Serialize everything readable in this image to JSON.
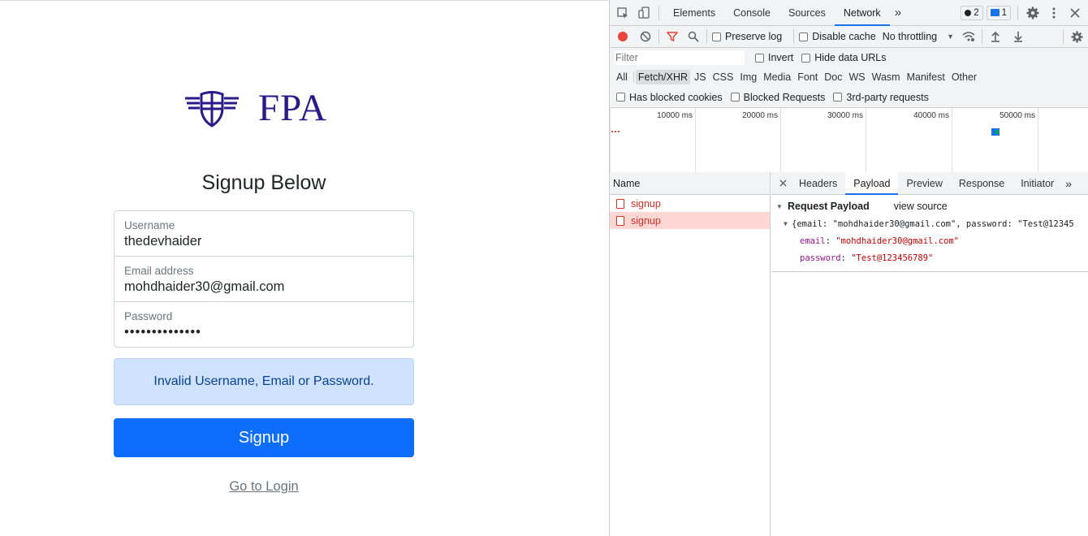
{
  "app": {
    "logo_text": "FPA",
    "heading": "Signup Below",
    "fields": {
      "username": {
        "label": "Username",
        "value": "thedevhaider"
      },
      "email": {
        "label": "Email address",
        "value": "mohdhaider30@gmail.com"
      },
      "password": {
        "label": "Password",
        "value": "••••••••••••••"
      }
    },
    "alert": "Invalid Username, Email or Password.",
    "signup_button": "Signup",
    "login_link": "Go to Login",
    "colors": {
      "primary": "#0d6efd",
      "alert_bg": "#cfe2ff",
      "alert_text": "#084298",
      "logo": "#2a1a8a"
    }
  },
  "devtools": {
    "tabs": [
      "Elements",
      "Console",
      "Sources",
      "Network"
    ],
    "active_tab": "Network",
    "more_tabs": "»",
    "errors_count": "2",
    "messages_count": "1",
    "toolbar": {
      "preserve_log": "Preserve log",
      "disable_cache": "Disable cache",
      "throttling": "No throttling"
    },
    "filter": {
      "placeholder": "Filter",
      "invert": "Invert",
      "hide_data_urls": "Hide data URLs"
    },
    "types": [
      "All",
      "Fetch/XHR",
      "JS",
      "CSS",
      "Img",
      "Media",
      "Font",
      "Doc",
      "WS",
      "Wasm",
      "Manifest",
      "Other"
    ],
    "active_type": "Fetch/XHR",
    "blocking": {
      "blocked_cookies": "Has blocked cookies",
      "blocked_requests": "Blocked Requests",
      "third_party": "3rd-party requests"
    },
    "timeline_ticks": [
      "10000 ms",
      "20000 ms",
      "30000 ms",
      "40000 ms",
      "50000 ms"
    ],
    "name_header": "Name",
    "requests": [
      "signup",
      "signup"
    ],
    "detail_tabs": [
      "Headers",
      "Payload",
      "Preview",
      "Response",
      "Initiator"
    ],
    "active_detail_tab": "Payload",
    "payload": {
      "title": "Request Payload",
      "view_source": "view source",
      "summary": "{email: \"mohdhaider30@gmail.com\", password: \"Test@12345",
      "email_key": "email",
      "email_value": "\"mohdhaider30@gmail.com\"",
      "password_key": "password",
      "password_value": "\"Test@123456789\""
    }
  }
}
